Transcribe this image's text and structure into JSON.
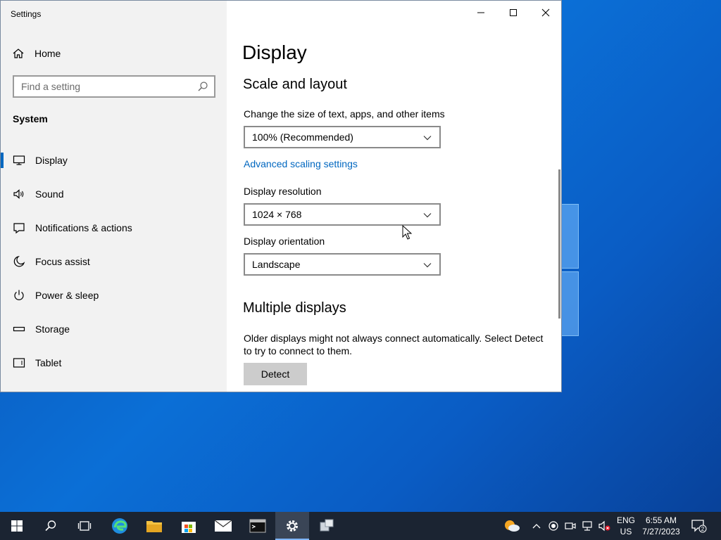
{
  "window": {
    "title": "Settings"
  },
  "sidebar": {
    "home_label": "Home",
    "search_placeholder": "Find a setting",
    "section": "System",
    "items": [
      {
        "label": "Display",
        "icon": "monitor-icon",
        "active": true
      },
      {
        "label": "Sound",
        "icon": "speaker-icon"
      },
      {
        "label": "Notifications & actions",
        "icon": "notification-icon"
      },
      {
        "label": "Focus assist",
        "icon": "moon-icon"
      },
      {
        "label": "Power & sleep",
        "icon": "power-icon"
      },
      {
        "label": "Storage",
        "icon": "storage-icon"
      },
      {
        "label": "Tablet",
        "icon": "tablet-icon"
      }
    ]
  },
  "content": {
    "title": "Display",
    "scale_heading": "Scale and layout",
    "scale_label": "Change the size of text, apps, and other items",
    "scale_value": "100% (Recommended)",
    "advanced_link": "Advanced scaling settings",
    "resolution_label": "Display resolution",
    "resolution_value": "1024 × 768",
    "orientation_label": "Display orientation",
    "orientation_value": "Landscape",
    "multi_heading": "Multiple displays",
    "multi_desc": "Older displays might not always connect automatically. Select Detect to try to connect to them.",
    "detect_button": "Detect"
  },
  "taskbar": {
    "icons": [
      "start-icon",
      "search-icon",
      "task-view-icon",
      "edge-icon",
      "file-explorer-icon",
      "store-icon",
      "mail-icon",
      "terminal-icon",
      "settings-icon",
      "app-icon"
    ],
    "active": "settings-icon",
    "lang_top": "ENG",
    "lang_bottom": "US",
    "time": "6:55 AM",
    "date": "7/27/2023",
    "notification_count": "2"
  },
  "colors": {
    "accent": "#0067c0",
    "sidebar_bg": "#f2f2f2",
    "taskbar_bg": "#1b2432"
  }
}
